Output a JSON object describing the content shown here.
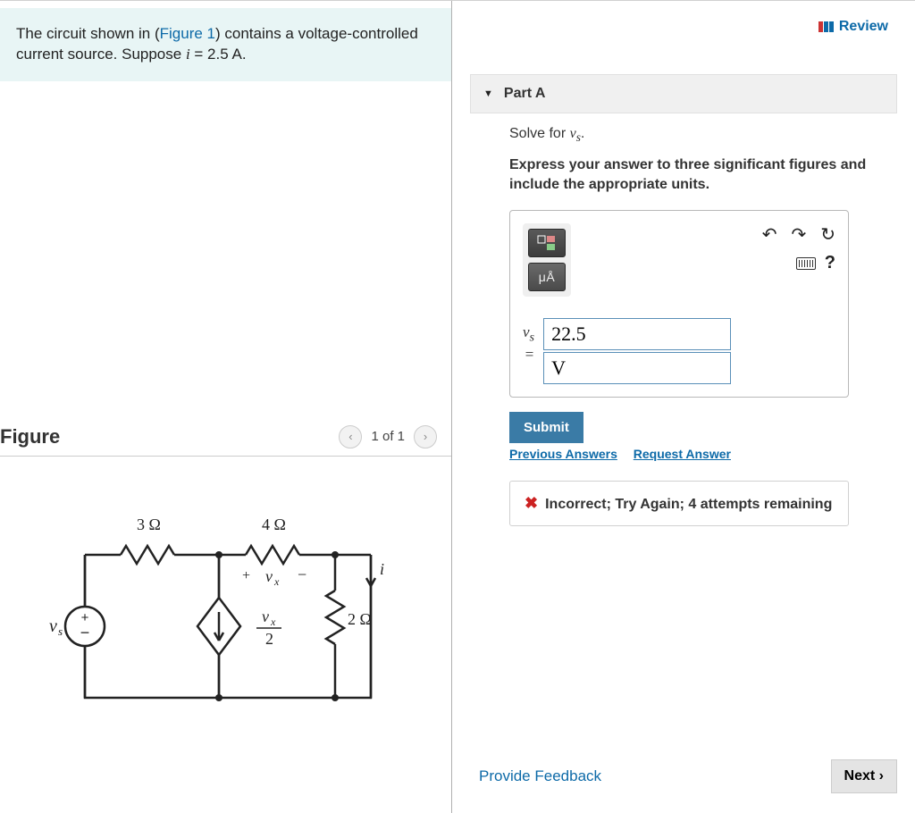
{
  "left": {
    "problem_html_pre": "The circuit shown in (",
    "figure_link": "Figure 1",
    "problem_html_mid": ") contains a voltage-controlled current source. Suppose ",
    "supposition_var": "i",
    "supposition_val": " = 2.5 A.",
    "figure_title": "Figure",
    "pager_text": "1 of 1",
    "circuit": {
      "r1": "3 Ω",
      "r2": "4 Ω",
      "r3": "2 Ω",
      "vx_label": "vₓ",
      "vs_label": "vₛ",
      "i_label": "i",
      "dep_src": "vₓ / 2"
    }
  },
  "right": {
    "review": "Review",
    "part_label": "Part A",
    "prompt": "Solve for vₛ.",
    "instruction": "Express your answer to three significant figures and include the appropriate units.",
    "units_btn": "μÅ",
    "var_label": "vₛ =",
    "value_input": "22.5",
    "unit_input": "V",
    "submit": "Submit",
    "prev_answers": "Previous Answers",
    "request_answer": "Request Answer",
    "feedback": "Incorrect; Try Again; 4 attempts remaining",
    "provide_feedback": "Provide Feedback",
    "next": "Next"
  }
}
